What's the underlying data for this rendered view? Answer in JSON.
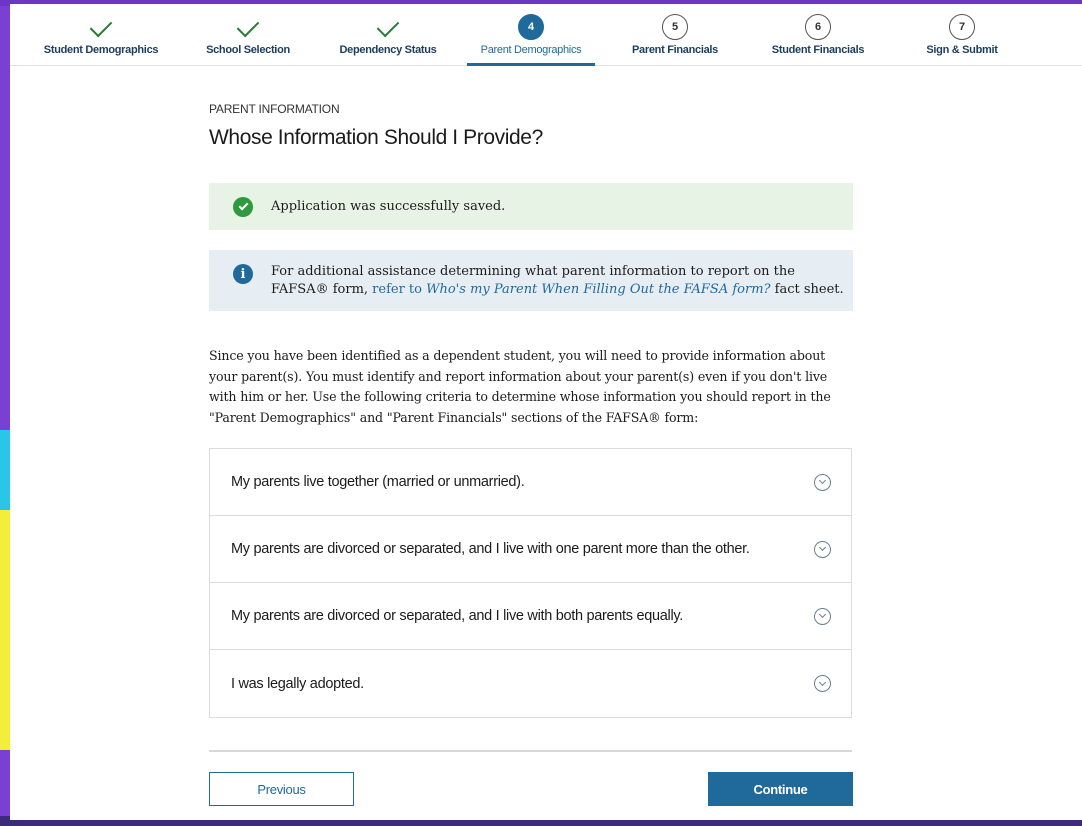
{
  "stepper": {
    "steps": [
      {
        "number": "",
        "label": "Student Demographics",
        "state": "complete"
      },
      {
        "number": "",
        "label": "School Selection",
        "state": "complete"
      },
      {
        "number": "",
        "label": "Dependency Status",
        "state": "complete"
      },
      {
        "number": "4",
        "label": "Parent Demographics",
        "state": "current"
      },
      {
        "number": "5",
        "label": "Parent Financials",
        "state": "upcoming"
      },
      {
        "number": "6",
        "label": "Student Financials",
        "state": "upcoming"
      },
      {
        "number": "7",
        "label": "Sign & Submit",
        "state": "upcoming"
      }
    ]
  },
  "page": {
    "eyebrow": "PARENT INFORMATION",
    "title": "Whose Information Should I Provide?"
  },
  "alerts": {
    "success_text": "Application was successfully saved.",
    "info_prefix": "For additional assistance determining what parent information to report on the FAFSA® form, ",
    "info_link_prefix": "refer to ",
    "info_link_italic": "Who's my Parent When Filling Out the FAFSA form?",
    "info_suffix": " fact sheet."
  },
  "intro": {
    "text": "Since you have been identified as a dependent student, you will need to provide information about your parent(s). You must identify and report information about your parent(s) even if you don't live with him or her. Use the following criteria to determine whose information you should report in the \"Parent Demographics\" and \"Parent Financials\" sections of the FAFSA® form:"
  },
  "accordion": {
    "items": [
      {
        "label": "My parents live together (married or unmarried)."
      },
      {
        "label": "My parents are divorced or separated, and I live with one parent more than the other."
      },
      {
        "label": "My parents are divorced or separated, and I live with both parents equally."
      },
      {
        "label": "I was legally adopted."
      }
    ]
  },
  "buttons": {
    "previous": "Previous",
    "continue": "Continue"
  },
  "colors": {
    "primary": "#1f6a9a",
    "success": "#2e9a3e",
    "check": "#2a7a3b"
  }
}
